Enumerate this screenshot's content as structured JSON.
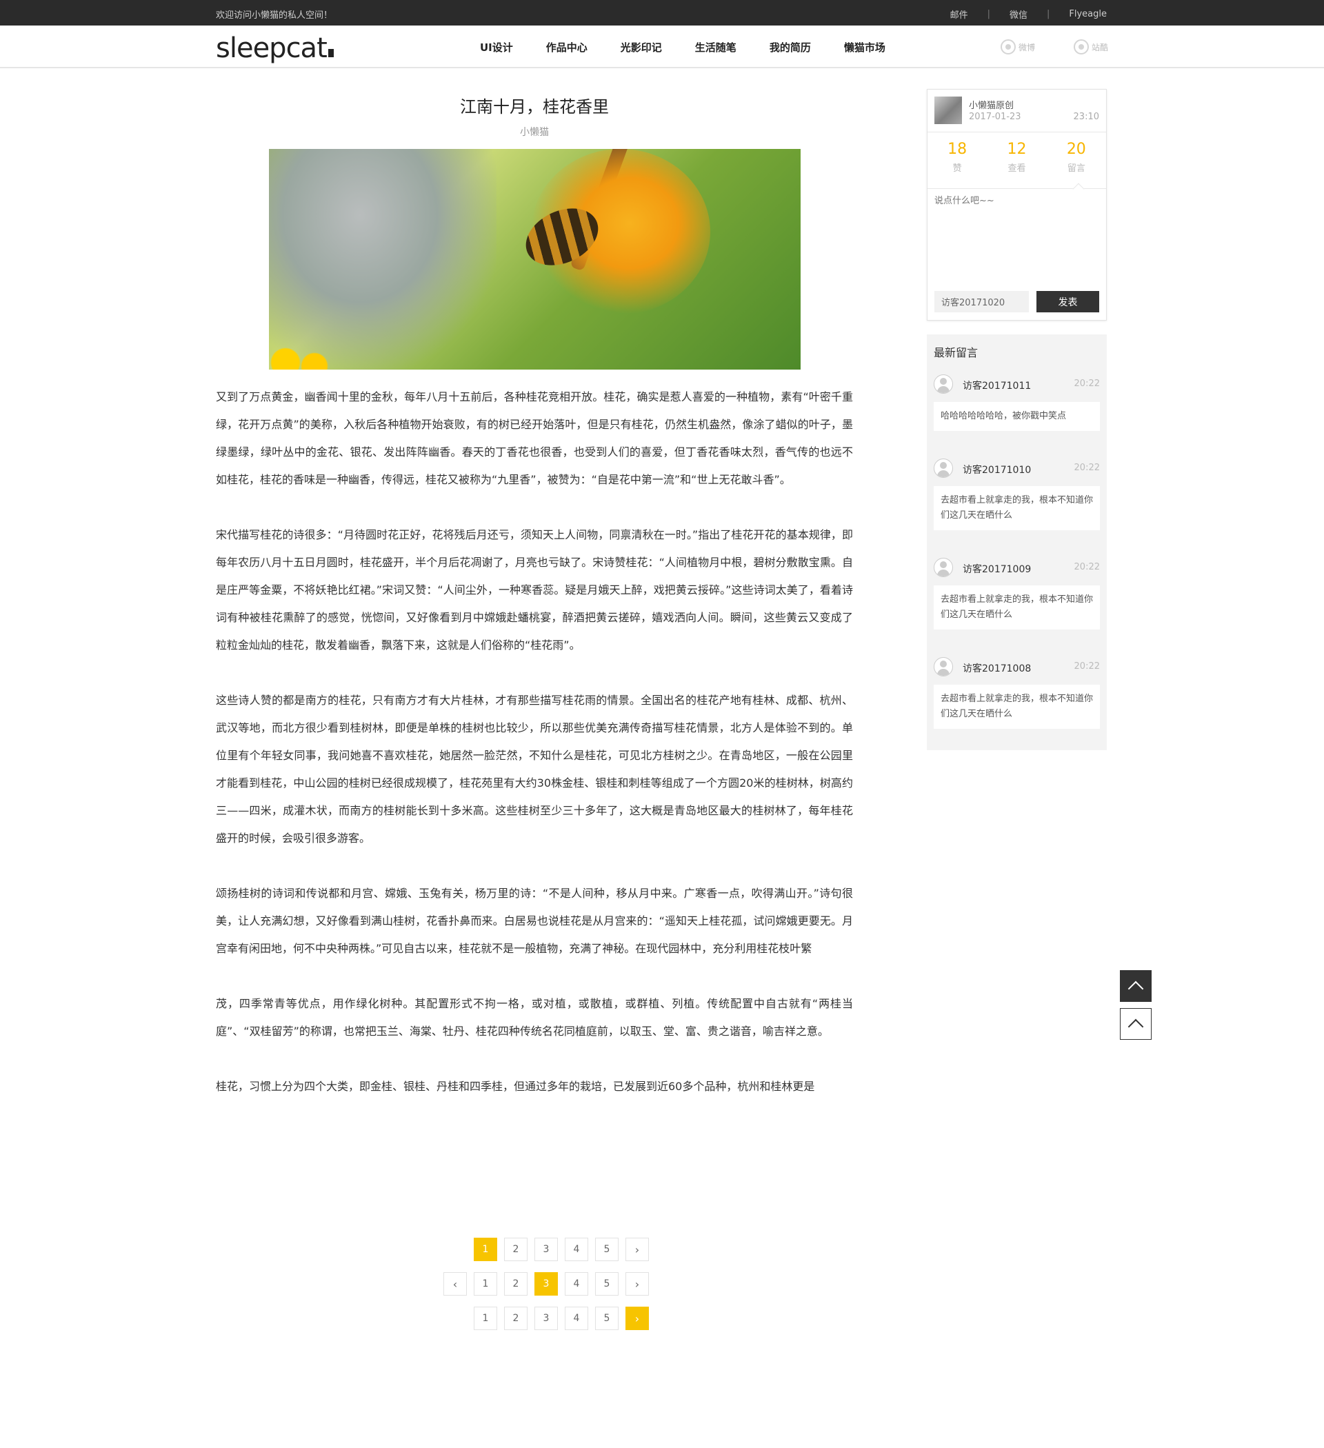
{
  "topbar": {
    "welcome": "欢迎访问小懒猫的私人空间！",
    "links": [
      "邮件",
      "微信",
      "Flyeagle"
    ],
    "separator": "|"
  },
  "header": {
    "logo": "sleepcat",
    "nav": [
      "UI设计",
      "作品中心",
      "光影印记",
      "生活随笔",
      "我的简历",
      "懒猫市场"
    ],
    "social": [
      "微博",
      "站酷"
    ]
  },
  "article": {
    "title": "江南十月，桂花香里",
    "author": "小懒猫",
    "image_icon": "osmanthus-bee-photo",
    "paragraphs": [
      "又到了万点黄金，幽香闻十里的金秋，每年八月十五前后，各种桂花竞相开放。桂花，确实是惹人喜爱的一种植物，素有“叶密千重绿，花开万点黄”的美称，入秋后各种植物开始衰败，有的树已经开始落叶，但是只有桂花，仍然生机盎然，像涂了蜡似的叶子，墨绿墨绿，绿叶丛中的金花、银花、发出阵阵幽香。春天的丁香花也很香，也受到人们的喜爱，但丁香花香味太烈，香气传的也远不如桂花，桂花的香味是一种幽香，传得远，桂花又被称为“九里香”，被赞为：“自是花中第一流”和“世上无花敢斗香”。",
      "宋代描写桂花的诗很多：“月待圆时花正好，花将残后月还亏，须知天上人间物，同禀清秋在一时。”指出了桂花开花的基本规律，即每年农历八月十五日月圆时，桂花盛开，半个月后花凋谢了，月亮也亏缺了。宋诗赞桂花：“人间植物月中根，碧树分敷散宝熏。自是庄严等金粟，不将妖艳比红裙。”宋词又赞：“人间尘外，一种寒香蕊。疑是月娥天上醉，戏把黄云挼碎。”这些诗词太美了，看着诗词有种被桂花熏醉了的感觉，恍惚间，又好像看到月中嫦娥赴蟠桃宴，醉酒把黄云搓碎，嬉戏洒向人间。瞬间，这些黄云又变成了粒粒金灿灿的桂花，散发着幽香，飘落下来，这就是人们俗称的“桂花雨”。",
      "这些诗人赞的都是南方的桂花，只有南方才有大片桂林，才有那些描写桂花雨的情景。全国出名的桂花产地有桂林、成都、杭州、武汉等地，而北方很少看到桂树林，即便是单株的桂树也比较少，所以那些优美充满传奇描写桂花情景，北方人是体验不到的。单位里有个年轻女同事，我问她喜不喜欢桂花，她居然一脸茫然，不知什么是桂花，可见北方桂树之少。在青岛地区，一般在公园里才能看到桂花，中山公园的桂树已经很成规模了，桂花苑里有大约30株金桂、银桂和刺桂等组成了一个方圆20米的桂树林，树高约三——四米，成灌木状，而南方的桂树能长到十多米高。这些桂树至少三十多年了，这大概是青岛地区最大的桂树林了，每年桂花盛开的时候，会吸引很多游客。",
      "颂扬桂树的诗词和传说都和月宫、嫦娥、玉兔有关，杨万里的诗：“不是人间种，移从月中来。广寒香一点，吹得满山开。”诗句很美，让人充满幻想，又好像看到满山桂树，花香扑鼻而来。白居易也说桂花是从月宫来的：“遥知天上桂花孤，试问嫦娥更要无。月宫幸有闲田地，何不中央种两株。”可见自古以来，桂花就不是一般植物，充满了神秘。在现代园林中，充分利用桂花枝叶繁",
      "茂，四季常青等优点，用作绿化树种。其配置形式不拘一格，或对植，或散植，或群植、列植。传统配置中自古就有“两桂当庭”、“双桂留芳”的称谓，也常把玉兰、海棠、牡丹、桂花四种传统名花同植庭前，以取玉、堂、富、贵之谐音，喻吉祥之意。",
      "桂花，习惯上分为四个大类，即金桂、银桂、丹桂和四季桂，但通过多年的栽培，已发展到近60多个品种，杭州和桂林更是"
    ]
  },
  "pagination": {
    "pages": [
      "1",
      "2",
      "3",
      "4",
      "5"
    ],
    "prev_icon": "chevron-left-icon",
    "next_icon": "chevron-right-icon",
    "prev_glyph": "‹",
    "next_glyph": "›",
    "accent": "#f7c400"
  },
  "profile": {
    "name": "小懒猫原创",
    "date": "2017-01-23",
    "time": "23:10",
    "stats": [
      {
        "value": "18",
        "label": "赞"
      },
      {
        "value": "12",
        "label": "查看"
      },
      {
        "value": "20",
        "label": "留言"
      }
    ],
    "comment_placeholder": "说点什么吧~~",
    "visitor_value": "访客20171020",
    "submit_label": "发表"
  },
  "latest": {
    "title": "最新留言",
    "messages": [
      {
        "name": "访客20171011",
        "time": "20:22",
        "text": "哈哈哈哈哈哈哈，被你戳中笑点"
      },
      {
        "name": "访客20171010",
        "time": "20:22",
        "text": "去超市看上就拿走的我，根本不知道你们这几天在晒什么"
      },
      {
        "name": "访客20171009",
        "time": "20:22",
        "text": "去超市看上就拿走的我，根本不知道你们这几天在晒什么"
      },
      {
        "name": "访客20171008",
        "time": "20:22",
        "text": "去超市看上就拿走的我，根本不知道你们这几天在晒什么"
      }
    ]
  },
  "totop": {
    "icon": "chevron-up-icon"
  }
}
